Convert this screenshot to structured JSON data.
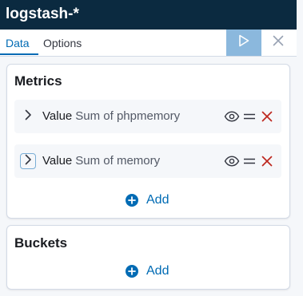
{
  "header": {
    "title": "logstash-*"
  },
  "tabs": [
    {
      "label": "Data",
      "active": true
    },
    {
      "label": "Options",
      "active": false
    }
  ],
  "colors": {
    "header_bg": "#0b2a40",
    "accent": "#006bb4",
    "danger": "#bd271e",
    "run_button": "#8bb8dd"
  },
  "metrics": {
    "title": "Metrics",
    "items": [
      {
        "label": "Value",
        "description": "Sum of phpmemory"
      },
      {
        "label": "Value",
        "description": "Sum of memory"
      }
    ],
    "add_label": "Add"
  },
  "buckets": {
    "title": "Buckets",
    "add_label": "Add"
  },
  "icons": {
    "run": "play-icon",
    "close": "close-icon",
    "toggle": "chevron-right-icon",
    "visibility": "eye-icon",
    "drag": "drag-handle-icon",
    "remove": "cross-icon",
    "add": "plus-circle-icon"
  }
}
